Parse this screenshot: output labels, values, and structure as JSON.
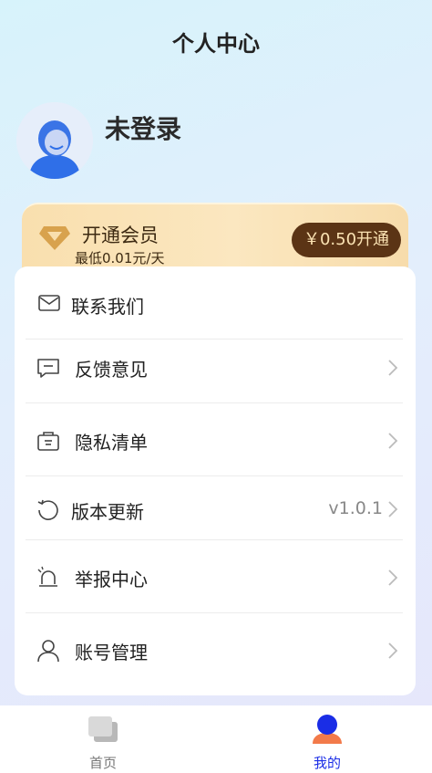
{
  "header": {
    "title": "个人中心"
  },
  "profile": {
    "username": "未登录"
  },
  "vip": {
    "title": "开通会员",
    "subtitle": "最低0.01元/天",
    "button_label": "￥0.50开通"
  },
  "menu": {
    "items": [
      {
        "label": "联系我们",
        "icon": "mail-icon",
        "value": "",
        "chevron": false
      },
      {
        "label": "反馈意见",
        "icon": "message-icon",
        "value": "",
        "chevron": true
      },
      {
        "label": "隐私清单",
        "icon": "privacy-list-icon",
        "value": "",
        "chevron": true
      },
      {
        "label": "版本更新",
        "icon": "refresh-icon",
        "value": "v1.0.1",
        "chevron": true
      },
      {
        "label": "举报中心",
        "icon": "alarm-icon",
        "value": "",
        "chevron": true
      },
      {
        "label": "账号管理",
        "icon": "user-icon",
        "value": "",
        "chevron": true
      }
    ]
  },
  "tabbar": {
    "tabs": [
      {
        "label": "首页",
        "icon": "home-cards-icon",
        "active": false
      },
      {
        "label": "我的",
        "icon": "profile-icon",
        "active": true
      }
    ]
  },
  "colors": {
    "accent": "#1a2de6",
    "vip_button": "#5b3415",
    "vip_card": "#f9dfae",
    "inactive_tab": "#777777"
  }
}
